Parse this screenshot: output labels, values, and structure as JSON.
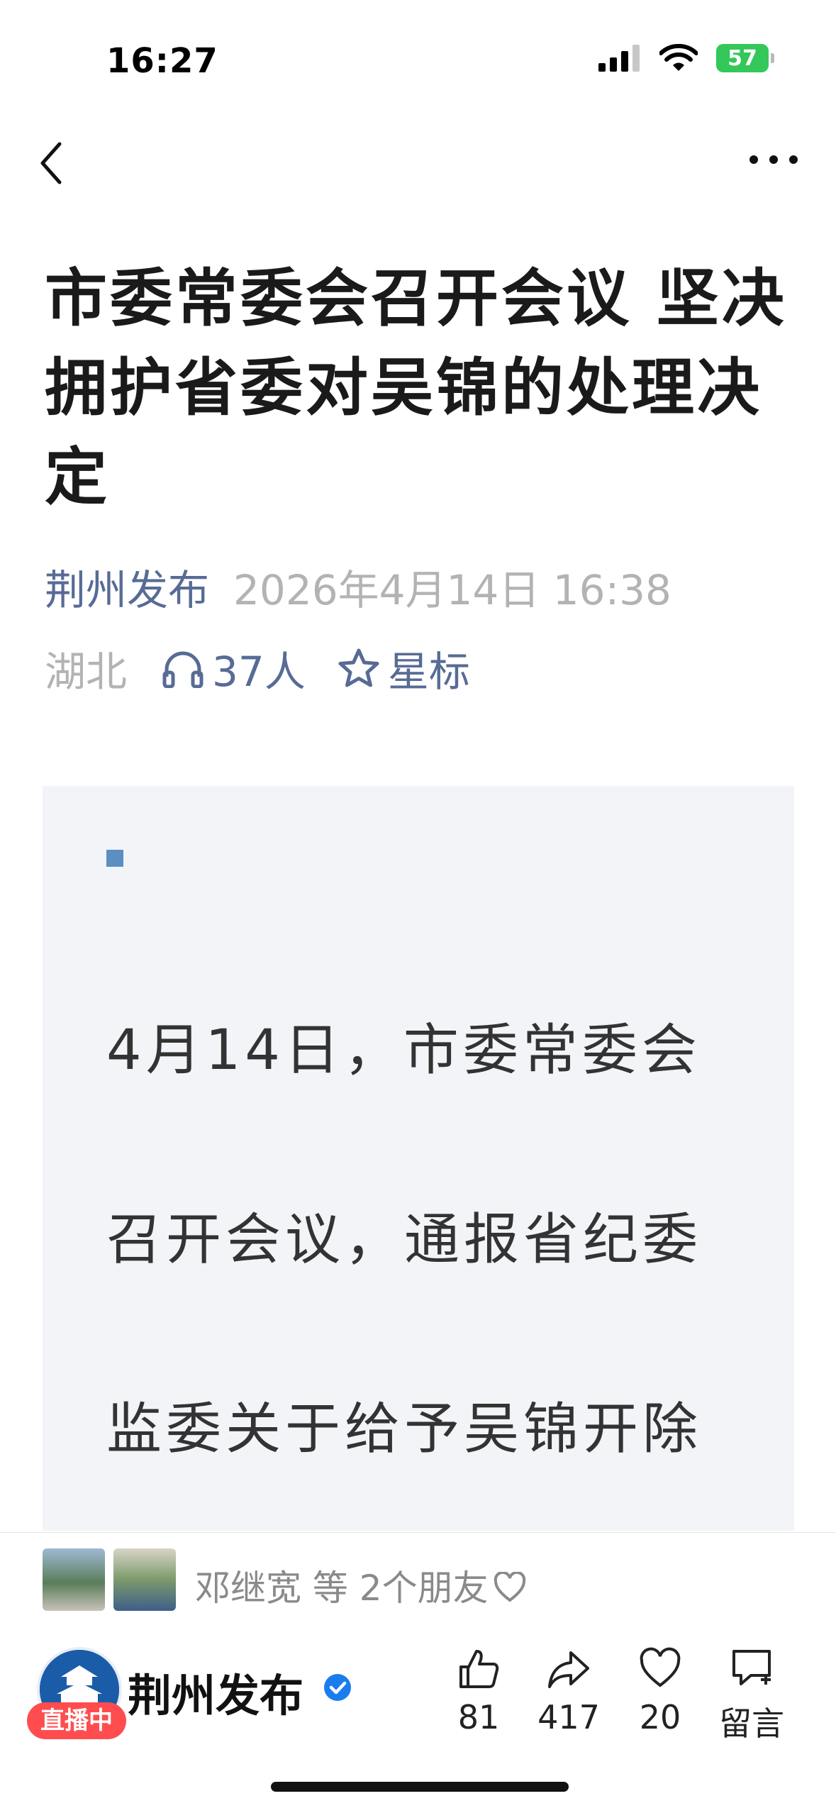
{
  "status_bar": {
    "time": "16:27",
    "battery": "57"
  },
  "article": {
    "title": "市委常委会召开会议 坚决拥护省委对吴锦的处理决定",
    "author": "荆州发布",
    "datetime": "2026年4月14日 16:38",
    "location": "湖北",
    "listeners": "37人",
    "star_label": "星标",
    "paragraph": "4月14日，市委常委会召开会议，通报省纪委监委关于给予吴锦开除"
  },
  "friends": {
    "text": "邓继宽 等 2个朋友"
  },
  "bottom_bar": {
    "account_name": "荆州发布",
    "live_label": "直播中",
    "likes": "81",
    "shares": "417",
    "favorites": "20",
    "comment_label": "留言"
  },
  "colors": {
    "link": "#576b95",
    "battery": "#34c759",
    "live": "#ff4d4f",
    "verified": "#1b7cf0"
  }
}
